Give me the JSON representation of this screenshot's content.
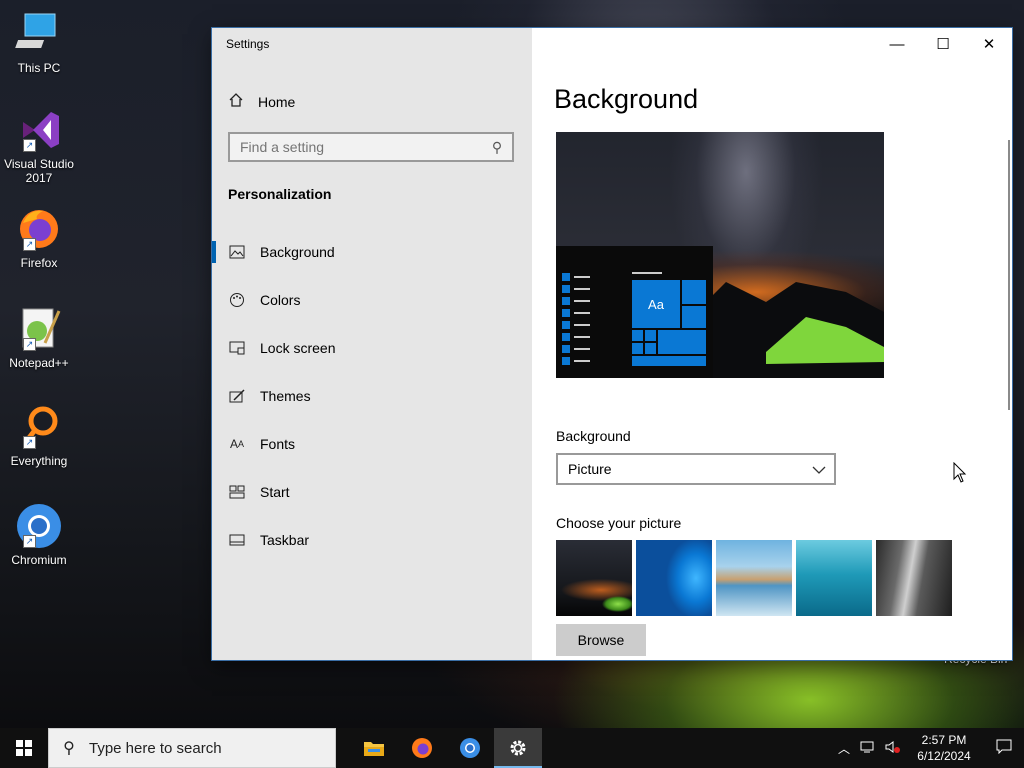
{
  "desktop": {
    "icons": [
      {
        "label": "This PC"
      },
      {
        "label": "Visual Studio 2017"
      },
      {
        "label": "Firefox"
      },
      {
        "label": "Notepad++"
      },
      {
        "label": "Everything"
      },
      {
        "label": "Chromium"
      }
    ],
    "recycle_bin_label": "Recycle Bin"
  },
  "window": {
    "title": "Settings",
    "controls": {
      "minimize": "—",
      "maximize": "☐",
      "close": "✕"
    }
  },
  "sidebar": {
    "home_label": "Home",
    "search_placeholder": "Find a setting",
    "category": "Personalization",
    "items": [
      {
        "label": "Background",
        "icon": "picture-icon",
        "selected": true
      },
      {
        "label": "Colors",
        "icon": "palette-icon"
      },
      {
        "label": "Lock screen",
        "icon": "lock-screen-icon"
      },
      {
        "label": "Themes",
        "icon": "themes-icon"
      },
      {
        "label": "Fonts",
        "icon": "fonts-icon"
      },
      {
        "label": "Start",
        "icon": "start-icon"
      },
      {
        "label": "Taskbar",
        "icon": "taskbar-icon"
      }
    ]
  },
  "main": {
    "title": "Background",
    "preview_tile_text": "Aa",
    "background_label": "Background",
    "background_value": "Picture",
    "choose_label": "Choose your picture",
    "thumbnails": [
      "night-tent",
      "windows-blue",
      "beach-rocks",
      "underwater-swimmer",
      "rock-cliff"
    ],
    "browse_label": "Browse"
  },
  "taskbar": {
    "search_placeholder": "Type here to search",
    "apps": [
      "file-explorer",
      "firefox",
      "chromium",
      "settings"
    ],
    "active_app": "settings",
    "time": "2:57 PM",
    "date": "6/12/2024"
  },
  "colors": {
    "accent": "#0078d7",
    "sidebar_bg": "#e6e6e6",
    "taskbar_bg": "#101010"
  }
}
